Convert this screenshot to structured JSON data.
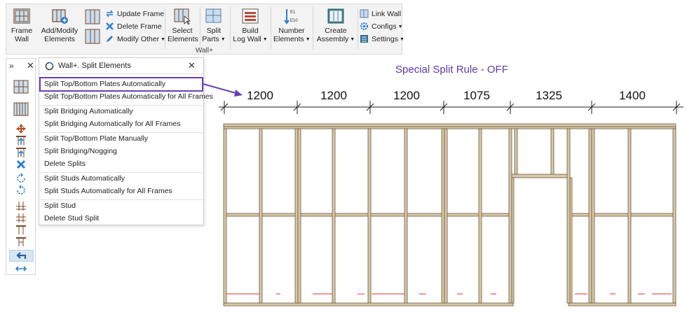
{
  "ribbon": {
    "frame_wall": "Frame Wall",
    "add_modify": "Add/Modify Elements",
    "update_frame": "Update Frame",
    "delete_frame": "Delete Frame",
    "modify_other": "Modify Other",
    "select_elements": "Select Elements",
    "split_parts": "Split Parts",
    "build_log_wall": "Build Log Wall",
    "number_elements": "Number Elements",
    "create_assembly": "Create Assembly",
    "link_wall": "Link Wall",
    "configs": "Configs",
    "settings": "Settings",
    "group_label": "Wall+"
  },
  "palette": {
    "expand_glyph": "»",
    "close_glyph": "✕"
  },
  "menu": {
    "title": "Wall+. Split Elements",
    "close_glyph": "✕",
    "items": [
      "Split Top/Bottom Plates Automatically",
      "Split Top/Bottom Plates Automatically for All Frames",
      "Split Bridging Automatically",
      "Split Bridging Automatically for All Frames",
      "Split Top/Bottom Plate Manually",
      "Split Bridging/Nogging",
      "Delete Splits",
      "Split Studs Automatically",
      "Split Studs Automatically for All Frames",
      "Split Stud",
      "Delete Stud Split"
    ]
  },
  "drawing": {
    "rule_label": "Special Split Rule - OFF",
    "dimensions": [
      "1200",
      "1200",
      "1200",
      "1075",
      "1325",
      "1400"
    ]
  },
  "colors": {
    "accent": "#6b3fb0",
    "rule_label": "#5b3aa8",
    "lumber": "#d8c8a8",
    "lumber_edge": "#6b5a3e",
    "split_mark": "#e03030"
  }
}
